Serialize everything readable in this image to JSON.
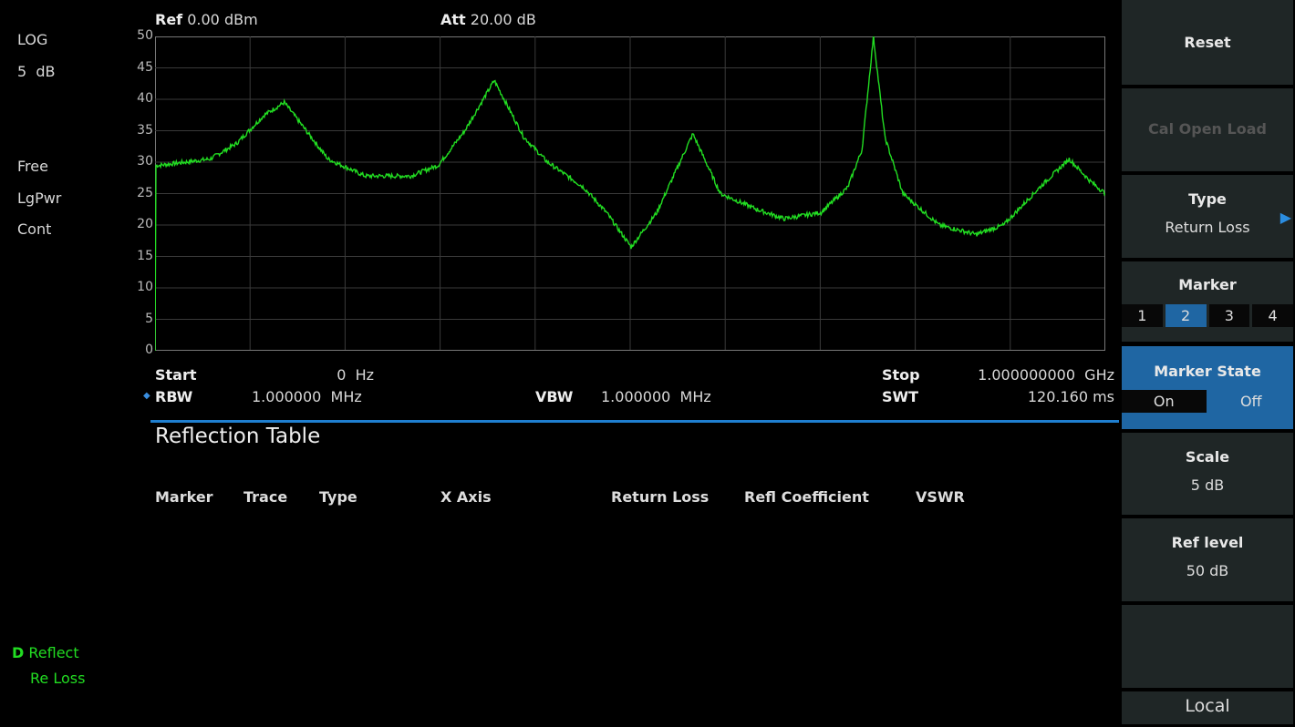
{
  "header": {
    "ref_label": "Ref",
    "ref_value": "0.00 dBm",
    "att_label": "Att",
    "att_value": "20.00 dB"
  },
  "left_status": {
    "scale_type": "LOG",
    "scale_div": "5  dB",
    "trigger": "Free",
    "detector": "LgPwr",
    "sweep": "Cont",
    "trace_label": "D",
    "trace_mode": "Reflect",
    "trace_measure": "Re Loss"
  },
  "footer": {
    "start_label": "Start",
    "start_value": "0  Hz",
    "stop_label": "Stop",
    "stop_value": "1.000000000  GHz",
    "rbw_label": "RBW",
    "rbw_value": "1.000000  MHz",
    "vbw_label": "VBW",
    "vbw_value": "1.000000  MHz",
    "swt_label": "SWT",
    "swt_value": "120.160 ms"
  },
  "table": {
    "title": "Reflection Table",
    "columns": [
      "Marker",
      "Trace",
      "Type",
      "X Axis",
      "Return Loss",
      "Refl Coefficient",
      "VSWR"
    ]
  },
  "softkeys": {
    "reset": "Reset",
    "cal_open_load": "Cal Open Load",
    "type_label": "Type",
    "type_value": "Return Loss",
    "marker_label": "Marker",
    "markers": [
      "1",
      "2",
      "3",
      "4"
    ],
    "marker_selected": "2",
    "marker_state_label": "Marker State",
    "marker_state_on": "On",
    "marker_state_off": "Off",
    "marker_state_selected": "Off",
    "scale_label": "Scale",
    "scale_value": "5 dB",
    "ref_level_label": "Ref level",
    "ref_level_value": "50 dB",
    "local": "Local"
  },
  "colors": {
    "trace": "#22dd22",
    "accent": "#1f66a3",
    "grid": "#3a3a3a"
  },
  "chart_data": {
    "type": "line",
    "xlim": [
      0,
      1000
    ],
    "x_unit": "MHz",
    "ylim": [
      0,
      50
    ],
    "y_ticks": [
      "50",
      "45",
      "40",
      "35",
      "30",
      "25",
      "20",
      "15",
      "10",
      "5",
      "0"
    ],
    "grid": true,
    "x": [
      0,
      1,
      5,
      58,
      86,
      115,
      136,
      154,
      182,
      221,
      269,
      298,
      326,
      357,
      388,
      413,
      451,
      475,
      501,
      528,
      566,
      595,
      633,
      662,
      701,
      729,
      744,
      756,
      768,
      787,
      825,
      864,
      893,
      931,
      962,
      984,
      1000
    ],
    "y": [
      0,
      29.5,
      29.5,
      30.5,
      33,
      37.5,
      39.5,
      36,
      30.5,
      27.8,
      27.8,
      29.5,
      35,
      43,
      34,
      30,
      26,
      22,
      16.5,
      22,
      34.5,
      25,
      22.5,
      21,
      22,
      26,
      32,
      50,
      34,
      25,
      20,
      18.5,
      20,
      26,
      30.5,
      27,
      25
    ]
  }
}
